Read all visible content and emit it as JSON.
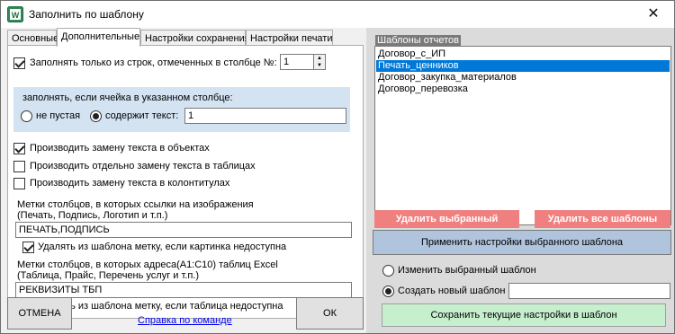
{
  "window": {
    "title": "Заполнить по шаблону",
    "close_icon": "✕"
  },
  "tabs": [
    {
      "label": "Основные"
    },
    {
      "label": "Дополнительные"
    },
    {
      "label": "Настройки сохранения"
    },
    {
      "label": "Настройки печати"
    }
  ],
  "fill_only": {
    "label": "Заполнять только из строк, отмеченных в столбце №:",
    "value": "1",
    "checked": true
  },
  "condition": {
    "label": "заполнять, если ячейка в указанном столбце:",
    "not_empty_label": "не пустая",
    "contains_label": "содержит текст:",
    "contains_value": "1"
  },
  "replace_objects": {
    "label": "Производить замену текста в объектах",
    "checked": true
  },
  "replace_tables": {
    "label": "Производить отдельно замену текста в таблицах",
    "checked": false
  },
  "replace_footers": {
    "label": "Производить замену текста в колонтитулах",
    "checked": false
  },
  "image_marks": {
    "label1": "Метки столбцов, в которых ссылки на изображения",
    "label2": "(Печать, Подпись, Логотип и т.п.)",
    "value": "ПЕЧАТЬ,ПОДПИСЬ",
    "remove_label": "Удалять из шаблона метку, если картинка недоступна",
    "remove_checked": true
  },
  "table_marks": {
    "label1": "Метки столбцов, в которых адреса(A1:C10) таблиц Excel",
    "label2": "(Таблица, Прайс, Перечень услуг и т.п.)",
    "value": "РЕКВИЗИТЫ ТБП",
    "remove_label": "Удалять из шаблона метку, если таблица недоступна",
    "remove_checked": true
  },
  "buttons": {
    "cancel": "ОТМЕНА",
    "ok": "ОК",
    "help_link": "Справка по команде"
  },
  "templates": {
    "label": "Шаблоны отчетов",
    "items": [
      "Договор_с_ИП",
      "Печать_ценников",
      "Договор_закупка_материалов",
      "Договор_перевозка"
    ],
    "selected_index": 1,
    "delete_selected": "Удалить выбранный",
    "delete_all": "Удалить все шаблоны",
    "apply": "Применить настройки выбранного шаблона",
    "edit_label": "Изменить выбранный шаблон",
    "create_label": "Создать новый шаблон",
    "new_name_value": "",
    "save": "Сохранить текущие настройки в шаблон"
  },
  "colors": {
    "selection": "#0078d7",
    "delete_button": "#f08080",
    "apply_button": "#b0c4de",
    "save_button": "#c6efce",
    "options_box": "#d4e3f2"
  }
}
